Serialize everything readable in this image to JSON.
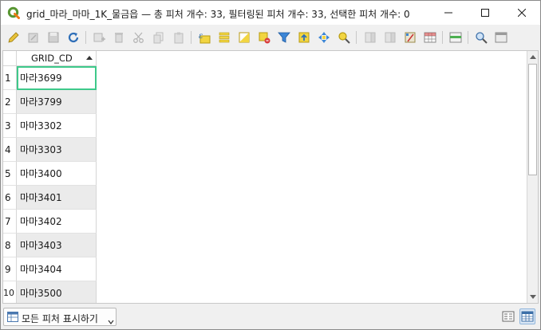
{
  "window": {
    "title": "grid_마라_마마_1K_물금읍 — 총 피처 개수: 33, 필터링된 피처 개수: 33, 선택한 피처 개수: 0",
    "app_icon": "qgis-logo-icon",
    "controls": [
      "minimize-icon",
      "maximize-icon",
      "close-icon"
    ]
  },
  "toolbar": {
    "icons": [
      "toggle-editing-icon",
      "multi-edit-icon",
      "save-edits-icon",
      "reload-icon",
      "add-feature-icon",
      "delete-feature-icon",
      "cut-icon",
      "copy-icon",
      "paste-icon",
      "expression-select-icon",
      "select-all-icon",
      "invert-selection-icon",
      "deselect-all-icon",
      "filter-selected-icon",
      "move-selection-top-icon",
      "pan-to-selection-icon",
      "zoom-to-selection-icon",
      "new-field-icon",
      "delete-field-icon",
      "field-calculator-icon",
      "conditional-format-icon",
      "dock-icon",
      "actions-icon",
      "dock-window-icon"
    ]
  },
  "table": {
    "column_header": "GRID_CD",
    "sort": "ascending",
    "rows": [
      {
        "num": "1",
        "value": "마라3699"
      },
      {
        "num": "2",
        "value": "마라3799"
      },
      {
        "num": "3",
        "value": "마마3302"
      },
      {
        "num": "4",
        "value": "마마3303"
      },
      {
        "num": "5",
        "value": "마마3400"
      },
      {
        "num": "6",
        "value": "마마3401"
      },
      {
        "num": "7",
        "value": "마마3402"
      },
      {
        "num": "8",
        "value": "마마3403"
      },
      {
        "num": "9",
        "value": "마마3404"
      },
      {
        "num": "10",
        "value": "마마3500"
      }
    ]
  },
  "bottom": {
    "filter_label": "모든 피처 표시하기",
    "view_buttons": [
      "form-view-icon",
      "table-view-icon"
    ]
  },
  "colors": {
    "selected_cell_border": "#3ec98a",
    "alt_row": "#ebebeb",
    "qgis_green": "#589632",
    "qgis_yellow": "#ee7913"
  }
}
